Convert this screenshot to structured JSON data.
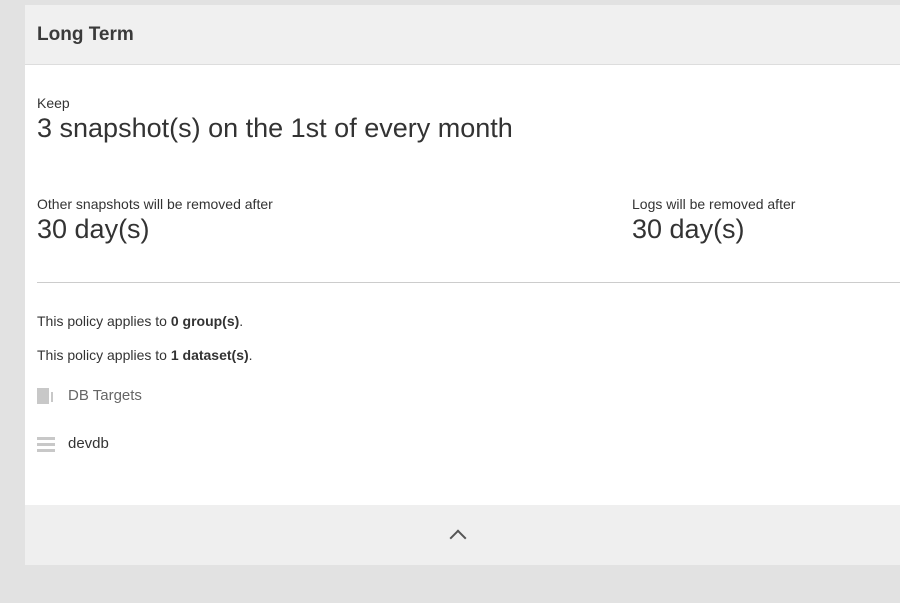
{
  "header": {
    "title": "Long Term"
  },
  "keep": {
    "label": "Keep",
    "value": "3 snapshot(s) on the 1st of every month"
  },
  "other": {
    "label": "Other snapshots will be removed after",
    "value": "30 day(s)"
  },
  "logs": {
    "label": "Logs will be removed after",
    "value": "30 day(s)"
  },
  "groups": {
    "prefix": "This policy applies to ",
    "count": "0 group(s)",
    "suffix": "."
  },
  "datasets": {
    "prefix": "This policy applies to ",
    "count": "1 dataset(s)",
    "suffix": "."
  },
  "tree": [
    {
      "label": "DB Targets",
      "icon": "folder-icon"
    },
    {
      "label": "devdb",
      "icon": "database-icon"
    }
  ],
  "footer": {
    "icon": "chevron-up-icon"
  }
}
